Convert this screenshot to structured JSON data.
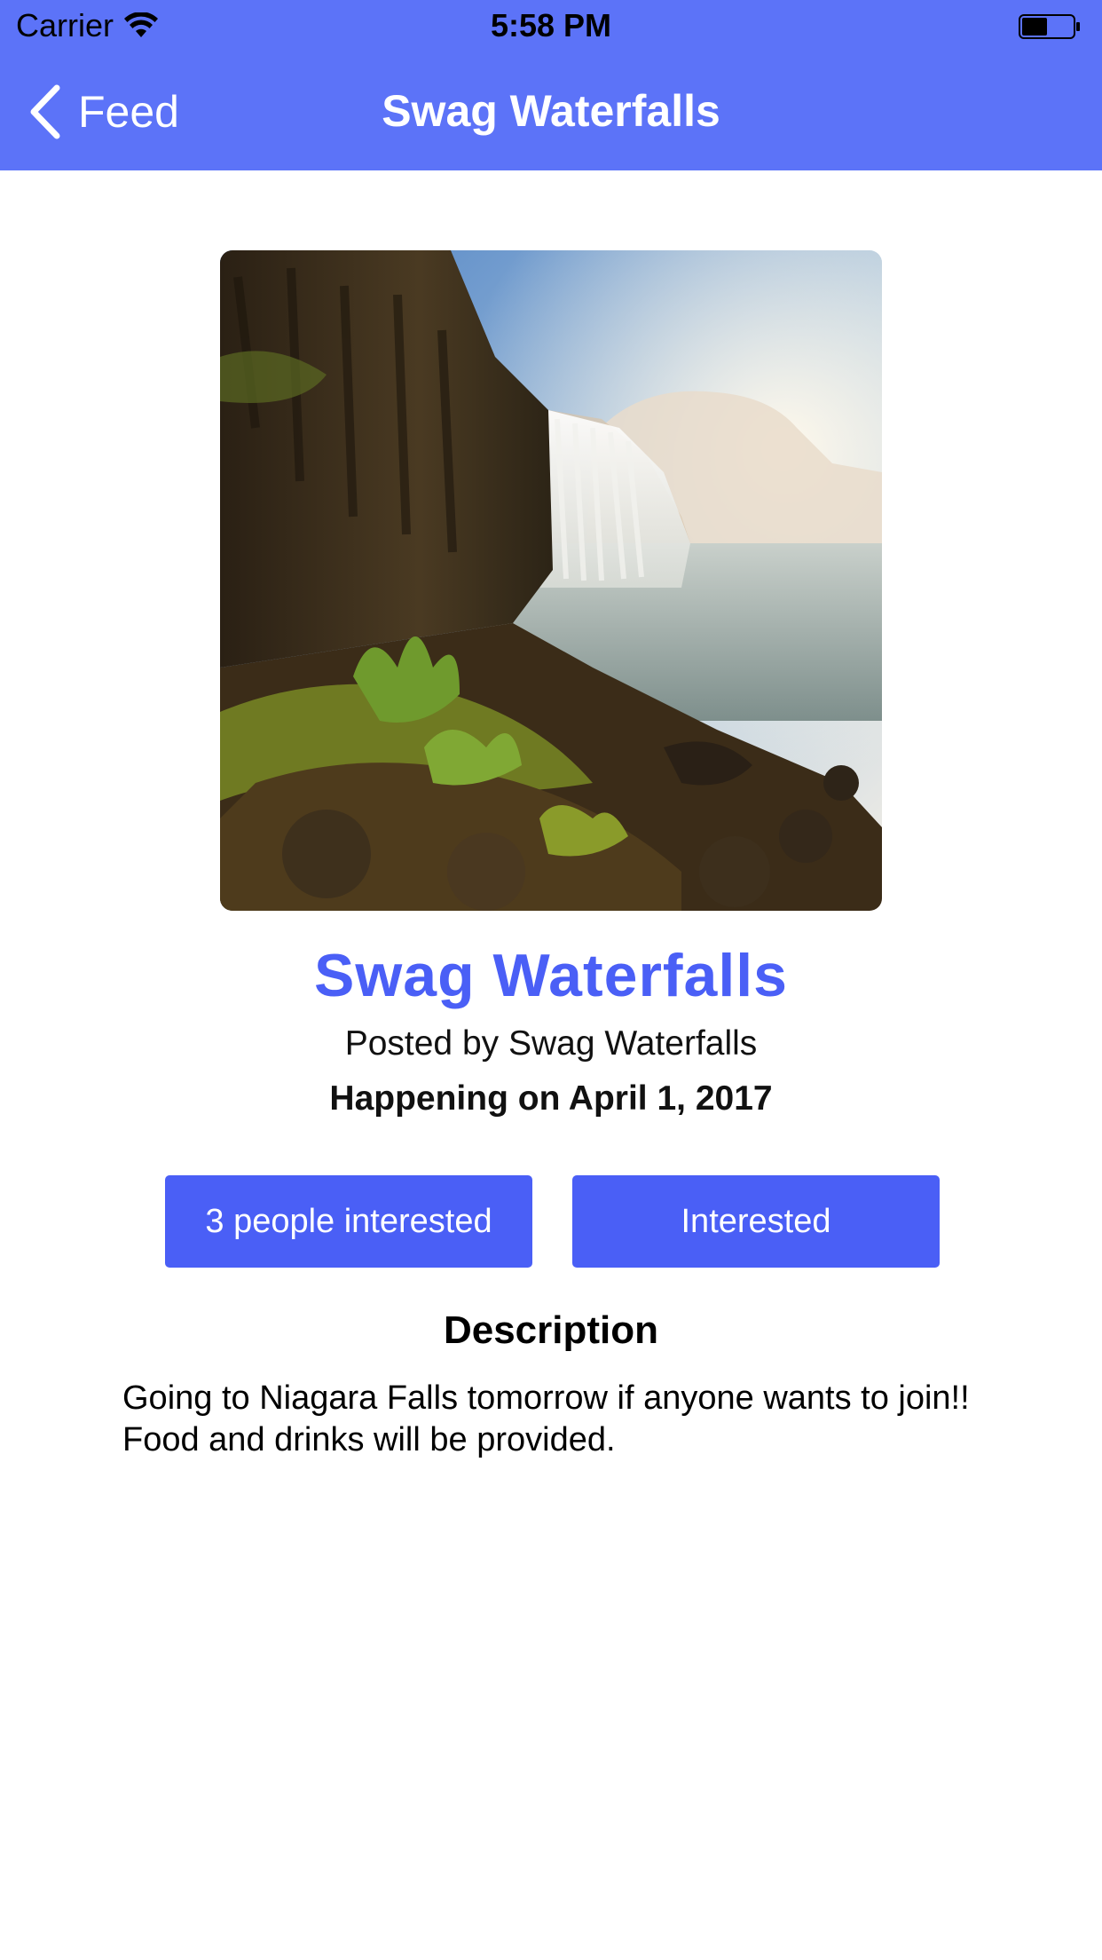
{
  "status_bar": {
    "carrier": "Carrier",
    "time": "5:58 PM",
    "icons": [
      "wifi-icon",
      "battery-icon"
    ]
  },
  "nav": {
    "back_label": "Feed",
    "back_icon": "chevron-left-icon",
    "title": "Swag Waterfalls",
    "background_color": "#5c73f8"
  },
  "event": {
    "title": "Swag Waterfalls",
    "posted_by": "Posted by Swag Waterfalls",
    "happening": "Happening on April 1, 2017",
    "accent_color": "#4a5ff6"
  },
  "actions": {
    "interested_count_label": "3 people interested",
    "interested_label": "Interested"
  },
  "description": {
    "heading": "Description",
    "body": "Going to Niagara Falls tomorrow if anyone wants to join!! Food and drinks will be provided."
  }
}
